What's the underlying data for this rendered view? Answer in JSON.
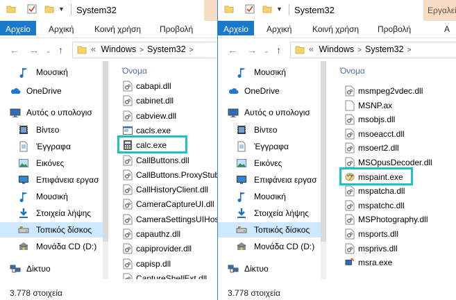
{
  "windows": {
    "left": {
      "title": "System32",
      "context_tab": "",
      "ribbon": {
        "file": "Αρχείο",
        "home": "Αρχική",
        "share": "Κοινή χρήση",
        "view": "Προβολή",
        "context": ""
      },
      "address": {
        "overflow": "«",
        "crumbs": [
          "Windows",
          "System32"
        ]
      },
      "nav_items": [
        "Μουσική",
        "OneDrive",
        "Αυτός ο υπολογισ",
        "Βίντεο",
        "Έγγραφα",
        "Εικόνες",
        "Επιφάνεια εργασ",
        "Μουσική",
        "Στοιχεία λήψης",
        "Τοπικός δίσκος",
        "Μονάδα CD (D:)",
        "Δίκτυο"
      ],
      "column_header": "Όνομα",
      "files": [
        "cabapi.dll",
        "cabinet.dll",
        "cabview.dll",
        "cacls.exe",
        "calc.exe",
        "CallButtons.dll",
        "CallButtons.ProxyStub",
        "CallHistoryClient.dll",
        "CameraCaptureUI.dll",
        "CameraSettingsUIHos",
        "capauthz.dll",
        "capiprovider.dll",
        "capisp.dll",
        "CaptureShellExt.dll"
      ],
      "highlighted_file": "calc.exe",
      "status": "3.778 στοιχεία"
    },
    "right": {
      "title": "System32",
      "context_tab": "Εργαλεί",
      "ribbon": {
        "file": "Αρχείο",
        "home": "Αρχική",
        "share": "Κοινή χρήση",
        "view": "Προβολή",
        "context": "Α"
      },
      "address": {
        "overflow": "«",
        "crumbs": [
          "Windows",
          "System32"
        ]
      },
      "nav_items": [
        "Μουσική",
        "OneDrive",
        "Αυτός ο υπολογισ",
        "Βίντεο",
        "Έγγραφα",
        "Εικόνες",
        "Επιφάνεια εργασ",
        "Μουσική",
        "Στοιχεία λήψης",
        "Τοπικός δίσκος",
        "Μονάδα CD (D:)",
        "Δίκτυο"
      ],
      "column_header": "Όνομα",
      "files": [
        "msmpeg2vdec.dll",
        "MSNP.ax",
        "msobjs.dll",
        "msoeacct.dll",
        "msoert2.dll",
        "MSOpusDecoder.dll",
        "mspaint.exe",
        "mspatcha.dll",
        "mspatchc.dll",
        "MSPhotography.dll",
        "msports.dll",
        "msprivs.dll",
        "msra.exe"
      ],
      "highlighted_file": "mspaint.exe",
      "status": "3.778 στοιχεία"
    }
  },
  "colors": {
    "accent": "#1979ca",
    "highlight": "#19c3c3",
    "selected_nav": "#cde8ff",
    "context_tab": "#f8dcc4"
  }
}
